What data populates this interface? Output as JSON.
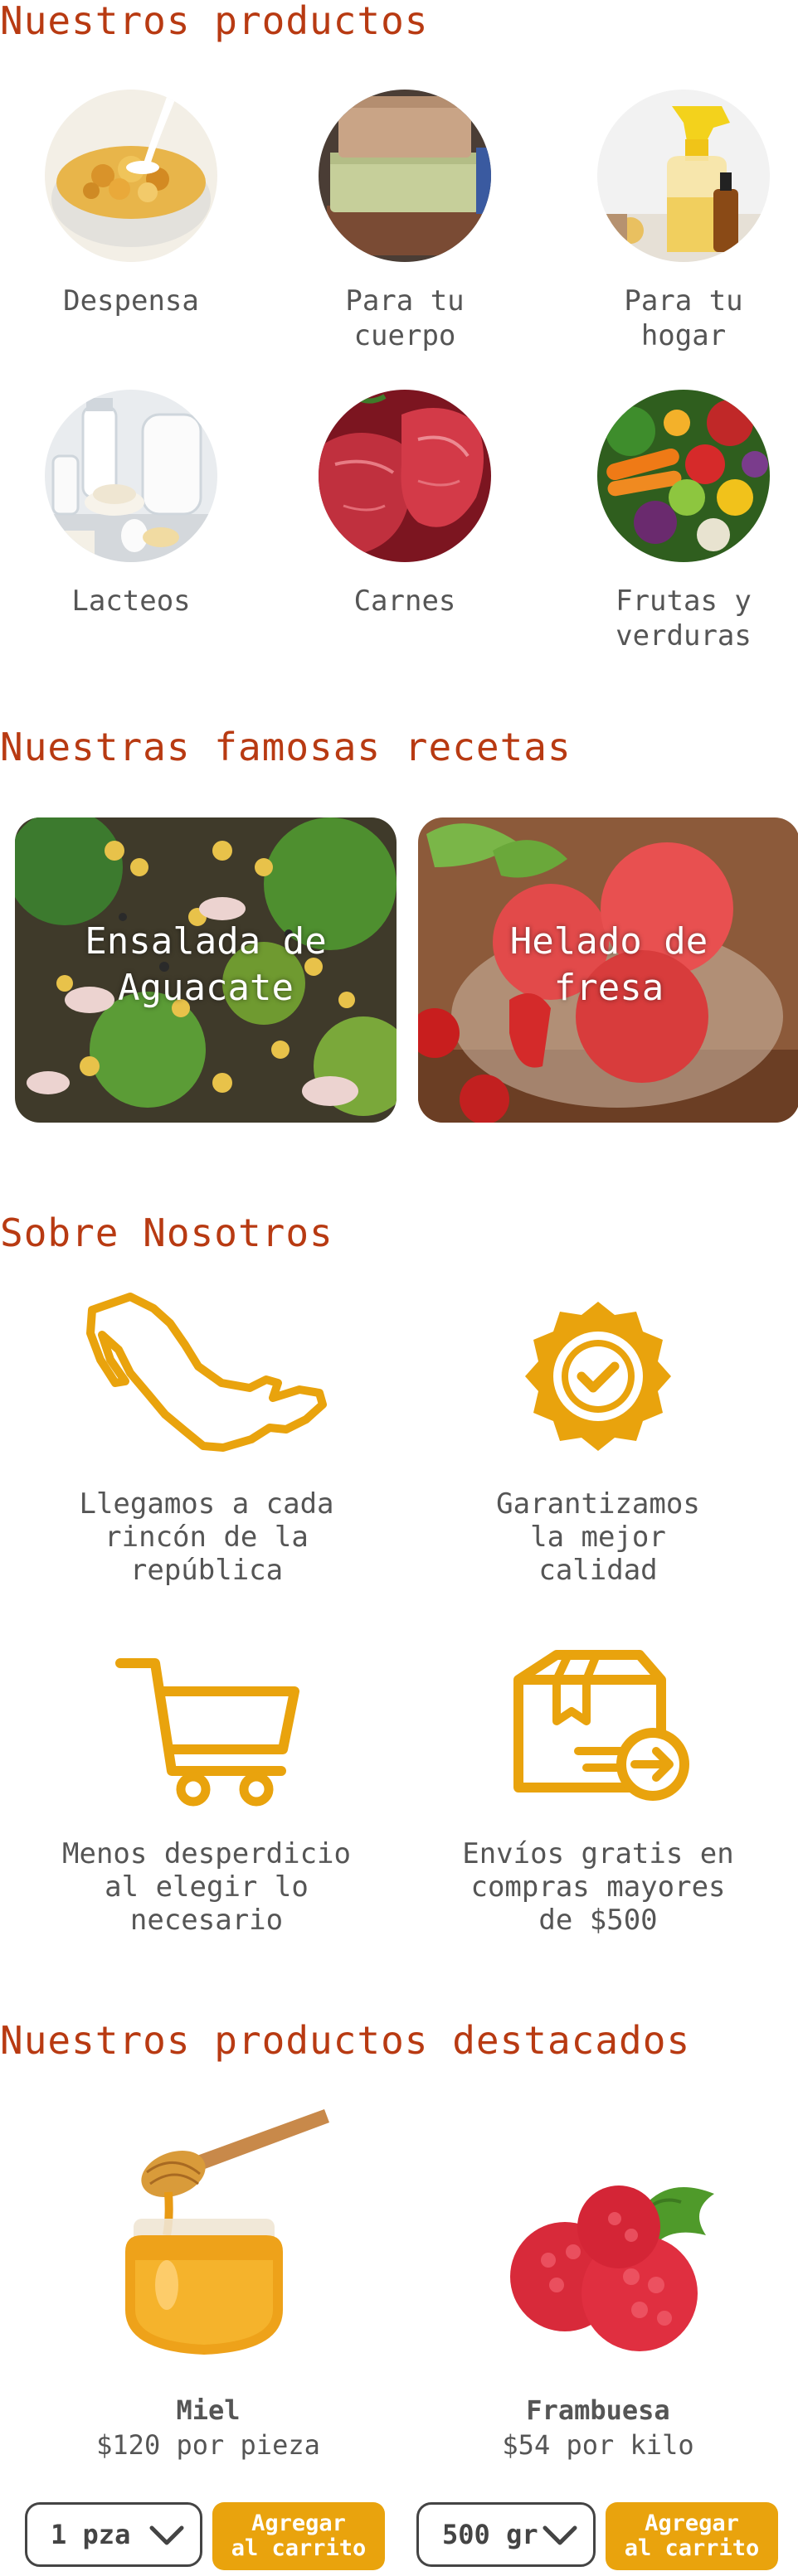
{
  "colors": {
    "title": "#b83a12",
    "accent": "#e9a30d",
    "text": "#555555"
  },
  "products_section": {
    "title": "Nuestros productos",
    "categories": [
      {
        "label": "Despensa",
        "icon": "cereal-bowl-image"
      },
      {
        "label": "Para tu\ncuerpo",
        "icon": "soap-bars-image"
      },
      {
        "label": "Para tu\nhogar",
        "icon": "cleaning-spray-image"
      },
      {
        "label": "Lacteos",
        "icon": "dairy-products-image"
      },
      {
        "label": "Carnes",
        "icon": "raw-meat-image"
      },
      {
        "label": "Frutas y\nverduras",
        "icon": "fruits-vegetables-image"
      }
    ]
  },
  "recipes_section": {
    "title": "Nuestras famosas recetas",
    "recipes": [
      {
        "title": "Ensalada de\nAguacate"
      },
      {
        "title": "Helado de\nfresa"
      }
    ]
  },
  "about_section": {
    "title": "Sobre Nosotros",
    "items": [
      {
        "text": "Llegamos a cada\nrincón de la\nrepública",
        "icon": "mexico-map-icon"
      },
      {
        "text": "Garantizamos\nla mejor\ncalidad",
        "icon": "quality-badge-icon"
      },
      {
        "text": "Menos desperdicio\nal elegir lo\nnecesario",
        "icon": "shopping-cart-icon"
      },
      {
        "text": "Envíos gratis en\ncompras mayores\nde $500",
        "icon": "shipping-box-icon"
      }
    ]
  },
  "featured_section": {
    "title": "Nuestros productos destacados",
    "products": [
      {
        "name": "Miel",
        "price": "$120 por pieza",
        "quantity": "1 pza",
        "button": "Agregar\nal carrito"
      },
      {
        "name": "Frambuesa",
        "price": "$54 por kilo",
        "quantity": "500 gr",
        "button": "Agregar\nal carrito"
      }
    ]
  }
}
